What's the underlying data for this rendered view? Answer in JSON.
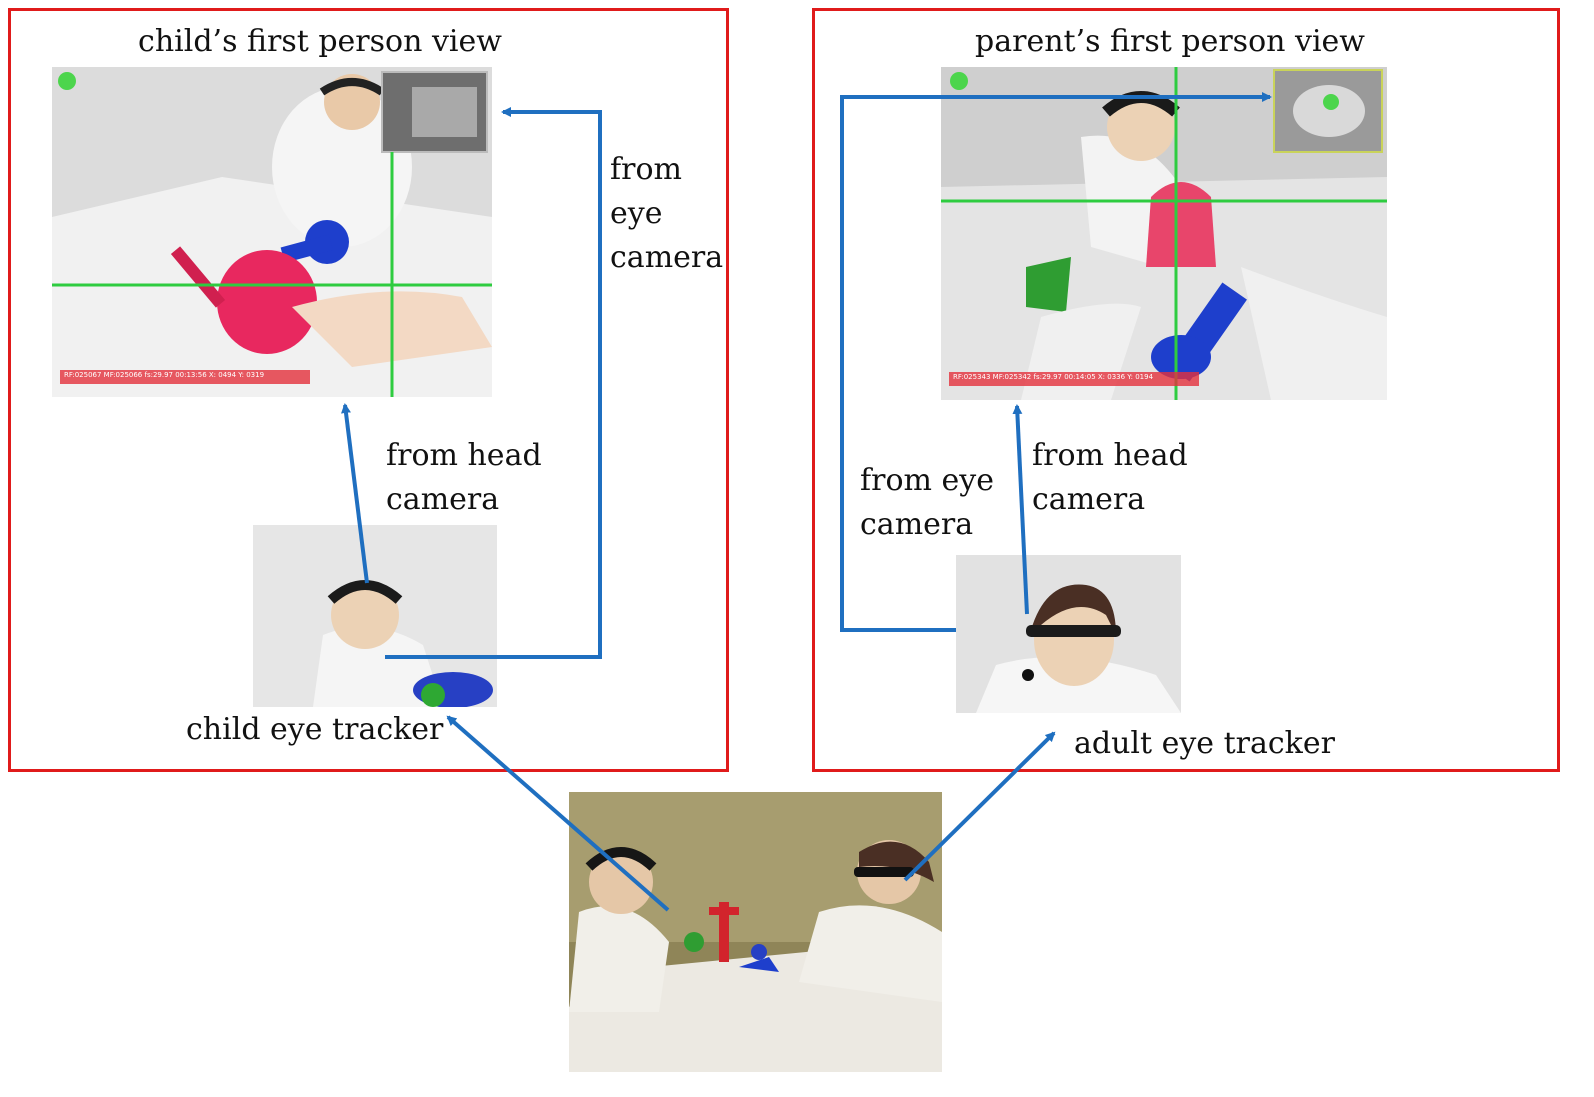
{
  "left_panel": {
    "title": "child’s first person view",
    "view_overlay": "RF:025067 MF:025066 fs:29.97 00:13:56 X: 0494 Y: 0319",
    "from_eye_camera": [
      "from",
      "eye",
      "camera"
    ],
    "from_head_camera": [
      "from head",
      "camera"
    ],
    "tracker_caption": "child eye tracker"
  },
  "right_panel": {
    "title": "parent’s first person view",
    "view_overlay": "RF:025343 MF:025342 fs:29.97 00:14:05 X: 0336 Y: 0194",
    "from_eye_camera": [
      "from eye",
      "camera"
    ],
    "from_head_camera": [
      "from head",
      "camera"
    ],
    "tracker_caption": "adult eye tracker"
  },
  "colors": {
    "panel_border": "#e01b1b",
    "arrow": "#1f6fc0",
    "gaze_crosshair": "#2ecc40",
    "overlay_text_bg": "#e3313c"
  }
}
